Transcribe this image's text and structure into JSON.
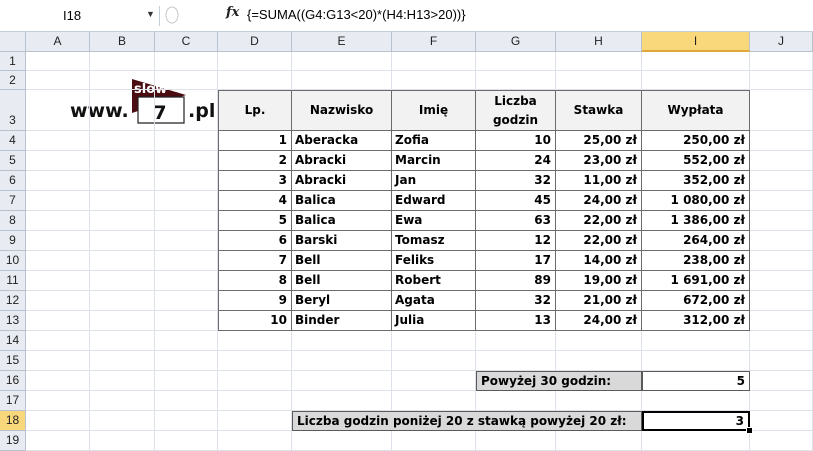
{
  "formula_bar": {
    "name_box": "I18",
    "fx_label": "fx",
    "formula": "{=SUMA((G4:G13<20)*(H4:H13>20))}"
  },
  "columns": [
    "A",
    "B",
    "C",
    "D",
    "E",
    "F",
    "G",
    "H",
    "I",
    "J"
  ],
  "rows": [
    "1",
    "2",
    "3",
    "4",
    "5",
    "6",
    "7",
    "8",
    "9",
    "10",
    "11",
    "12",
    "13",
    "14",
    "15",
    "16",
    "17",
    "18",
    "19"
  ],
  "selected_cell": {
    "column": "I",
    "row": "18"
  },
  "logo": {
    "prefix": "www.",
    "word": "slow",
    "number": "7",
    "suffix": ".pl"
  },
  "table": {
    "headers": [
      "Lp.",
      "Nazwisko",
      "Imię",
      "Liczba godzin",
      "Stawka",
      "Wypłata"
    ],
    "rows": [
      [
        "1",
        "Aberacka",
        "Zofia",
        "10",
        "25,00 zł",
        "250,00 zł"
      ],
      [
        "2",
        "Abracki",
        "Marcin",
        "24",
        "23,00 zł",
        "552,00 zł"
      ],
      [
        "3",
        "Abracki",
        "Jan",
        "32",
        "11,00 zł",
        "352,00 zł"
      ],
      [
        "4",
        "Balica",
        "Edward",
        "45",
        "24,00 zł",
        "1 080,00 zł"
      ],
      [
        "5",
        "Balica",
        "Ewa",
        "63",
        "22,00 zł",
        "1 386,00 zł"
      ],
      [
        "6",
        "Barski",
        "Tomasz",
        "12",
        "22,00 zł",
        "264,00 zł"
      ],
      [
        "7",
        "Bell",
        "Feliks",
        "17",
        "14,00 zł",
        "238,00 zł"
      ],
      [
        "8",
        "Bell",
        "Robert",
        "89",
        "19,00 zł",
        "1 691,00 zł"
      ],
      [
        "9",
        "Beryl",
        "Agata",
        "32",
        "21,00 zł",
        "672,00 zł"
      ],
      [
        "10",
        "Binder",
        "Julia",
        "13",
        "24,00 zł",
        "312,00 zł"
      ]
    ]
  },
  "summary": {
    "above30_label": "Powyżej 30 godzin:",
    "above30_value": "5",
    "below20_label": "Liczba godzin poniżej 20 z stawką powyżej 20 zł:",
    "below20_value": "3"
  },
  "colors": {
    "header_bg": "#e8ecf2",
    "selected_header": "#f9d87c",
    "label_fill": "#d9d9d9",
    "logo_dark": "#4a0e12"
  }
}
